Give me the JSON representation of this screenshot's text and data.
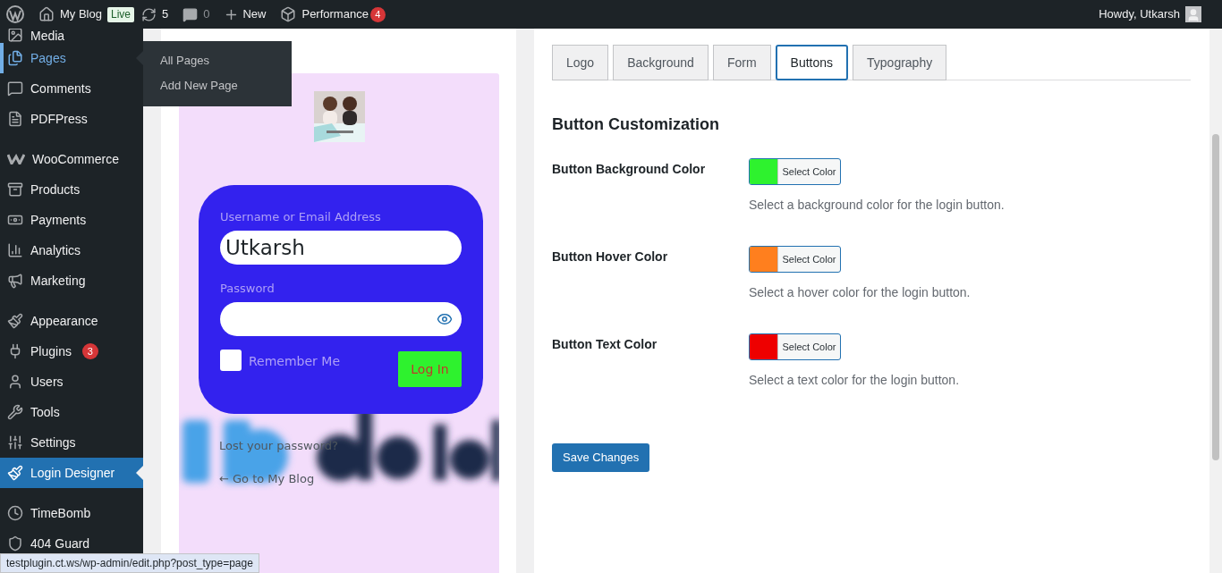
{
  "admin_bar": {
    "site": "My Blog",
    "badge": "Live",
    "updates": "5",
    "comments": "0",
    "new": "New",
    "performance": "Performance",
    "performance_count": "4",
    "greeting": "Howdy, Utkarsh"
  },
  "sidebar": {
    "groups": [
      {
        "items": [
          {
            "label": "Media",
            "highlighted": false,
            "selected": false
          },
          {
            "label": "Pages",
            "highlighted": true,
            "selected": false
          },
          {
            "label": "Comments",
            "highlighted": false,
            "selected": false
          },
          {
            "label": "PDFPress",
            "highlighted": false,
            "selected": false
          }
        ]
      },
      {
        "items": [
          {
            "label": "WooCommerce",
            "highlighted": false,
            "selected": false
          },
          {
            "label": "Products",
            "highlighted": false,
            "selected": false
          },
          {
            "label": "Payments",
            "highlighted": false,
            "selected": false
          },
          {
            "label": "Analytics",
            "highlighted": false,
            "selected": false
          },
          {
            "label": "Marketing",
            "highlighted": false,
            "selected": false
          }
        ]
      },
      {
        "items": [
          {
            "label": "Appearance",
            "highlighted": false,
            "selected": false
          },
          {
            "label": "Plugins",
            "highlighted": false,
            "selected": false,
            "badge": "3"
          },
          {
            "label": "Users",
            "highlighted": false,
            "selected": false
          },
          {
            "label": "Tools",
            "highlighted": false,
            "selected": false
          },
          {
            "label": "Settings",
            "highlighted": false,
            "selected": false
          },
          {
            "label": "Login Designer",
            "highlighted": false,
            "selected": true
          }
        ]
      },
      {
        "items": [
          {
            "label": "TimeBomb",
            "highlighted": false,
            "selected": false
          },
          {
            "label": "404 Guard",
            "highlighted": false,
            "selected": false
          }
        ]
      }
    ]
  },
  "flyout": {
    "items": [
      "All Pages",
      "Add New Page"
    ]
  },
  "preview": {
    "username_label": "Username or Email Address",
    "username_value": "Utkarsh",
    "password_label": "Password",
    "remember_label": "Remember Me",
    "remember_checked": false,
    "login_button": "Log In",
    "lost_password": "Lost your password?",
    "back_link": "← Go to My Blog"
  },
  "tabs": [
    {
      "label": "Logo",
      "selected": false
    },
    {
      "label": "Background",
      "selected": false
    },
    {
      "label": "Form",
      "selected": false
    },
    {
      "label": "Buttons",
      "selected": true
    },
    {
      "label": "Typography",
      "selected": false
    }
  ],
  "section_title": "Button Customization",
  "settings": [
    {
      "label": "Button Background Color",
      "color": "#2ef22e",
      "button": "Select Color",
      "description": "Select a background color for the login button."
    },
    {
      "label": "Button Hover Color",
      "color": "#ff7f1e",
      "button": "Select Color",
      "description": "Select a hover color for the login button."
    },
    {
      "label": "Button Text Color",
      "color": "#ee0000",
      "button": "Select Color",
      "description": "Select a text color for the login button."
    }
  ],
  "save_button": "Save Changes",
  "status_url": "testplugin.ct.ws/wp-admin/edit.php?post_type=page"
}
